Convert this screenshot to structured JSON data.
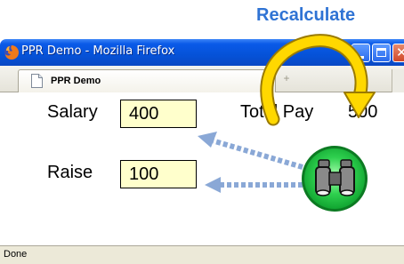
{
  "annotation": {
    "title": "Recalculate"
  },
  "window": {
    "title": "PPR Demo - Mozilla Firefox",
    "tab_label": "PPR Demo",
    "status_text": "Done"
  },
  "form": {
    "salary_label": "Salary",
    "salary_value": "400",
    "raise_label": "Raise",
    "raise_value": "100",
    "total_label": "Total Pay",
    "total_value": "500"
  },
  "colors": {
    "annotation_blue": "#2f73d4",
    "field_bg": "#ffffcc",
    "arrow_yellow": "#ffd700",
    "dotted_arrow": "#8aa8d6",
    "badge_green": "#22c94a"
  },
  "icons": {
    "titlebar": "firefox-icon",
    "tab": "page-icon",
    "badge": "binoculars-icon",
    "new_tab": "new-tab-icon"
  }
}
